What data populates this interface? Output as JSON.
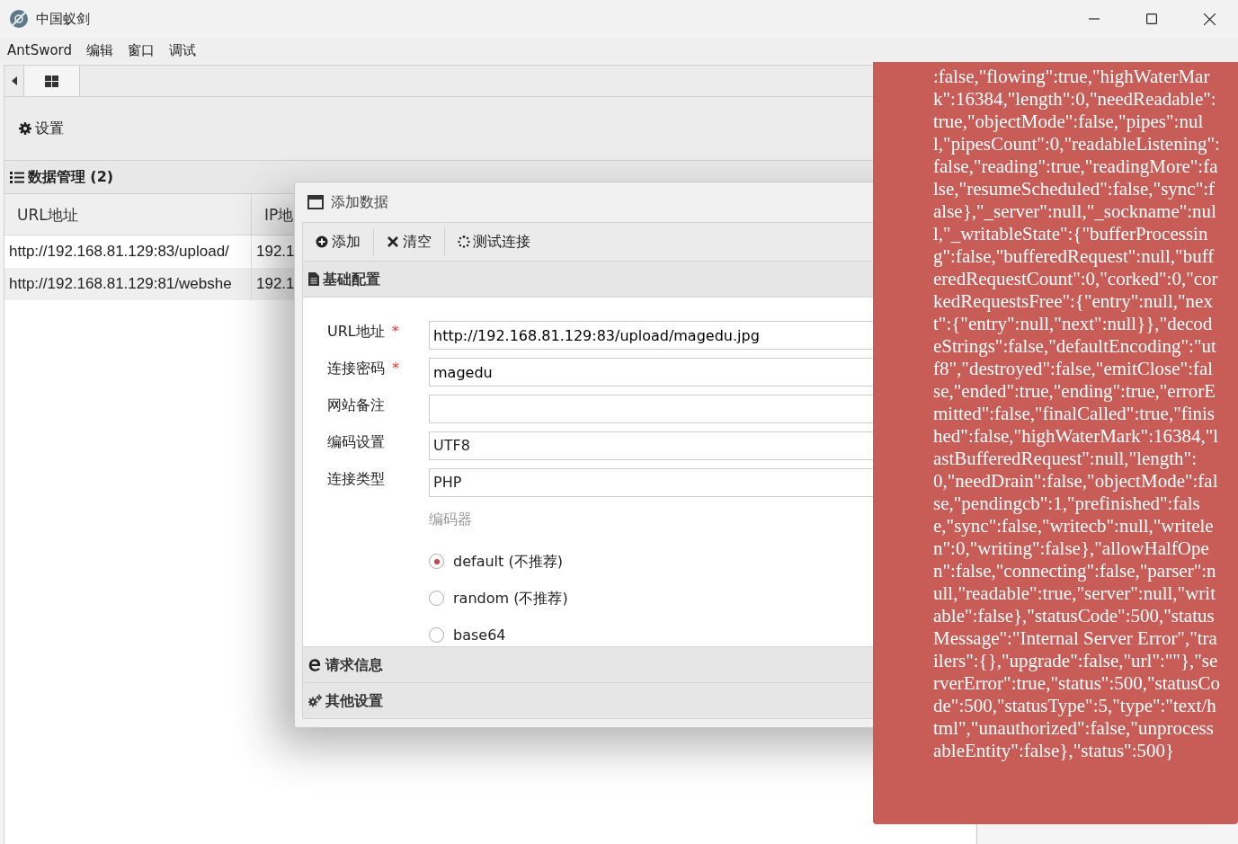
{
  "window": {
    "title": "中国蚁剑"
  },
  "menu": [
    "AntSword",
    "编辑",
    "窗口",
    "调试"
  ],
  "toolbar": {
    "settings": "设置"
  },
  "data_panel": {
    "title": "数据管理 (2)",
    "columns": [
      "URL地址",
      "IP地"
    ],
    "rows": [
      [
        "http://192.168.81.129:83/upload/",
        "192.1"
      ],
      [
        "http://192.168.81.129:81/webshe",
        "192.1"
      ]
    ]
  },
  "dialog": {
    "title": "添加数据",
    "toolbar": [
      {
        "kind": "add",
        "label": "添加"
      },
      {
        "kind": "clear",
        "label": "清空"
      },
      {
        "kind": "test",
        "label": "测试连接"
      }
    ],
    "section": "基础配置",
    "fields": [
      {
        "kind": "text",
        "label": "URL地址",
        "required_mark": "*",
        "value": "http://192.168.81.129:83/upload/magedu.jpg"
      },
      {
        "kind": "text",
        "label": "连接密码",
        "required_mark": "*",
        "value": "magedu"
      },
      {
        "kind": "text",
        "label": "网站备注"
      },
      {
        "kind": "select",
        "label": "编码设置",
        "value": "UTF8"
      },
      {
        "kind": "select",
        "label": "连接类型",
        "value": "PHP"
      }
    ],
    "encoder_label": "编码器",
    "encoders": [
      {
        "label": "default (不推荐)",
        "selected": true
      },
      {
        "label": "random (不推荐)",
        "selected": false
      },
      {
        "label": "base64",
        "selected": false
      }
    ],
    "sections": [
      {
        "kind": "request",
        "label": "请求信息"
      },
      {
        "kind": "other",
        "label": "其他设置"
      }
    ]
  },
  "error": {
    "message": ":false,\"flowing\":true,\"highWaterMark\":16384,\"length\":0,\"needReadable\":true,\"objectMode\":false,\"pipes\":null,\"pipesCount\":0,\"readableListening\":false,\"reading\":true,\"readingMore\":false,\"resumeScheduled\":false,\"sync\":false},\"_server\":null,\"_sockname\":null,\"_writableState\":{\"bufferProcessing\":false,\"bufferedRequest\":null,\"bufferedRequestCount\":0,\"corked\":0,\"corkedRequestsFree\":{\"entry\":null,\"next\":{\"entry\":null,\"next\":null}},\"decodeStrings\":false,\"defaultEncoding\":\"utf8\",\"destroyed\":false,\"emitClose\":false,\"ended\":true,\"ending\":true,\"errorEmitted\":false,\"finalCalled\":true,\"finished\":false,\"highWaterMark\":16384,\"lastBufferedRequest\":null,\"length\":0,\"needDrain\":false,\"objectMode\":false,\"pendingcb\":1,\"prefinished\":false,\"sync\":false,\"writecb\":null,\"writelen\":0,\"writing\":false},\"allowHalfOpen\":false,\"connecting\":false,\"parser\":null,\"readable\":true,\"server\":null,\"writable\":false},\"statusCode\":500,\"statusMessage\":\"Internal Server Error\",\"trailers\":{},\"upgrade\":false,\"url\":\"\"},\"serverError\":true,\"status\":500,\"statusCode\":500,\"statusType\":5,\"type\":\"text/html\",\"unauthorized\":false,\"unprocessableEntity\":false},\"status\":500}"
  }
}
